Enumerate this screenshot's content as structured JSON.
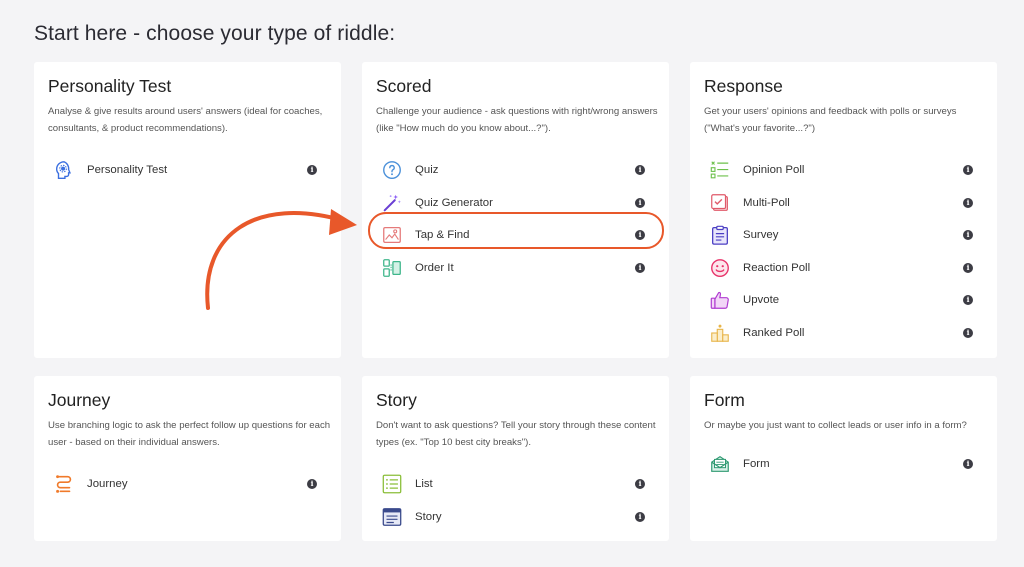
{
  "header": {
    "title": "Start here - choose your type of riddle:"
  },
  "cards": {
    "personality": {
      "title": "Personality Test",
      "desc": "Analyse & give results around users' answers (ideal for coaches, consultants, & product recommendations).",
      "items": [
        {
          "label": "Personality Test",
          "icon": "head-gear-icon"
        }
      ]
    },
    "scored": {
      "title": "Scored",
      "desc": "Challenge your audience - ask questions with right/wrong answers (like \"How much do you know about...?\").",
      "items": [
        {
          "label": "Quiz",
          "icon": "question-circle-icon"
        },
        {
          "label": "Quiz Generator",
          "icon": "magic-wand-icon"
        },
        {
          "label": "Tap & Find",
          "icon": "image-pin-icon"
        },
        {
          "label": "Order It",
          "icon": "order-blocks-icon"
        }
      ]
    },
    "response": {
      "title": "Response",
      "desc": "Get your users' opinions and feedback with polls or surveys (\"What's your favorite...?\")",
      "items": [
        {
          "label": "Opinion Poll",
          "icon": "checklist-icon"
        },
        {
          "label": "Multi-Poll",
          "icon": "multi-check-icon"
        },
        {
          "label": "Survey",
          "icon": "clipboard-icon"
        },
        {
          "label": "Reaction Poll",
          "icon": "smiley-icon"
        },
        {
          "label": "Upvote",
          "icon": "thumbs-up-icon"
        },
        {
          "label": "Ranked Poll",
          "icon": "podium-icon"
        }
      ]
    },
    "journey": {
      "title": "Journey",
      "desc": "Use branching logic to ask the perfect follow up questions for each user - based on their individual answers.",
      "items": [
        {
          "label": "Journey",
          "icon": "branch-path-icon"
        }
      ]
    },
    "story": {
      "title": "Story",
      "desc": "Don't want to ask questions? Tell your story through these content types (ex. \"Top 10 best city breaks\").",
      "items": [
        {
          "label": "List",
          "icon": "list-icon"
        },
        {
          "label": "Story",
          "icon": "story-window-icon"
        }
      ]
    },
    "form": {
      "title": "Form",
      "desc": "Or maybe you just want to collect leads or user info in a form?",
      "items": [
        {
          "label": "Form",
          "icon": "form-envelope-icon"
        }
      ]
    }
  },
  "info_glyph": "i",
  "colors": {
    "accent": "#e8582a",
    "background": "#f4f4f6",
    "card": "#ffffff"
  }
}
